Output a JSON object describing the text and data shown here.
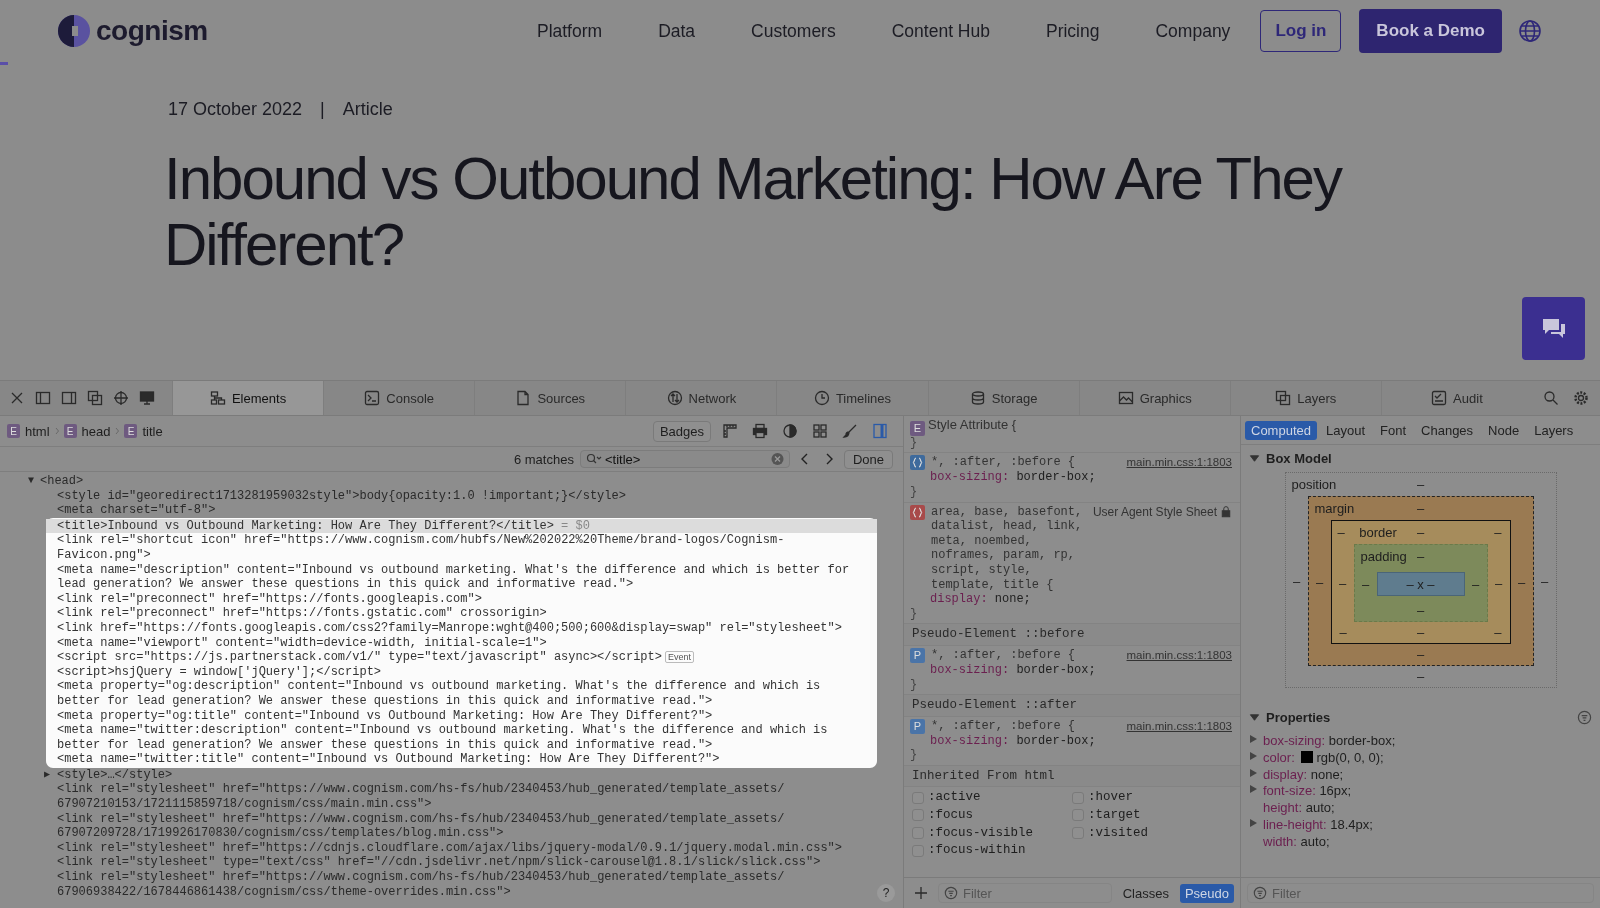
{
  "page": {
    "logo": "cognism",
    "nav": [
      "Platform",
      "Data",
      "Customers",
      "Content Hub",
      "Pricing",
      "Company"
    ],
    "login": "Log in",
    "demo": "Book a Demo",
    "reading_progress": {
      "level": 0.005
    },
    "date": "17 October 2022",
    "separator": "|",
    "category": "Article",
    "headline": "Inbound vs Outbound Marketing: How Are They Different?"
  },
  "devtools": {
    "tabs": [
      {
        "label": "Elements",
        "selected": true
      },
      {
        "label": "Console",
        "selected": false
      },
      {
        "label": "Sources",
        "selected": false
      },
      {
        "label": "Network",
        "selected": false
      },
      {
        "label": "Timelines",
        "selected": false
      },
      {
        "label": "Storage",
        "selected": false
      },
      {
        "label": "Graphics",
        "selected": false
      },
      {
        "label": "Layers",
        "selected": false
      },
      {
        "label": "Audit",
        "selected": false
      }
    ],
    "breadcrumb": [
      {
        "badge": "E",
        "label": "html"
      },
      {
        "badge": "E",
        "label": "head"
      },
      {
        "badge": "E",
        "label": "title"
      }
    ],
    "badges_button": "Badges",
    "search": {
      "matches": "6 matches",
      "value": "<title>",
      "done": "Done"
    },
    "dom": [
      {
        "toggle": "▼",
        "text": "<head>",
        "children": [
          {
            "text": "<style id=\"georedirect1713281959032style\">body{opacity:1.0 !important;}</style>",
            "highlighted": false,
            "selected": false
          },
          {
            "text": "<meta charset=\"utf-8\">",
            "highlighted": false,
            "selected": false
          },
          {
            "text": "<title>Inbound vs Outbound Marketing: How Are They Different?</title>",
            "suffix": "= $0",
            "highlighted": true,
            "selected": true
          },
          {
            "text": "<link rel=\"shortcut icon\" href=\"https://www.cognism.com/hubfs/New%202022%20Theme/brand-logos/Cognism-Favicon.png\">",
            "highlighted": true,
            "selected": false
          },
          {
            "text": "<meta name=\"description\" content=\"Inbound vs outbound marketing. What's the difference and which is better for lead generation? We answer these questions in this quick and informative read.\">",
            "highlighted": true,
            "selected": false
          },
          {
            "text": "<link rel=\"preconnect\" href=\"https://fonts.googleapis.com\">",
            "highlighted": true,
            "selected": false
          },
          {
            "text": "<link rel=\"preconnect\" href=\"https://fonts.gstatic.com\" crossorigin>",
            "highlighted": true,
            "selected": false
          },
          {
            "text": "<link href=\"https://fonts.googleapis.com/css2?family=Manrope:wght@400;500;600&display=swap\" rel=\"stylesheet\">",
            "highlighted": true,
            "selected": false
          },
          {
            "text": "<meta name=\"viewport\" content=\"width=device-width, initial-scale=1\">",
            "highlighted": true,
            "selected": false
          },
          {
            "text": "<script src=\"https://js.partnerstack.com/v1/\" type=\"text/javascript\" async></script>",
            "badge": "Event",
            "highlighted": true,
            "selected": false
          },
          {
            "text": "<script>hsjQuery = window['jQuery'];</script>",
            "highlighted": true,
            "selected": false
          },
          {
            "text": "<meta property=\"og:description\" content=\"Inbound vs outbound marketing. What's the difference and which is better for lead generation? We answer these questions in this quick and informative read.\">",
            "highlighted": true,
            "selected": false
          },
          {
            "text": "<meta property=\"og:title\" content=\"Inbound vs Outbound Marketing: How Are They Different?\">",
            "highlighted": true,
            "selected": false
          },
          {
            "text": "<meta name=\"twitter:description\" content=\"Inbound vs outbound marketing. What's the difference and which is better for lead generation? We answer these questions in this quick and informative read.\">",
            "highlighted": true,
            "selected": false
          },
          {
            "text": "<meta name=\"twitter:title\" content=\"Inbound vs Outbound Marketing: How Are They Different?\">",
            "highlighted": true,
            "selected": false
          },
          {
            "toggle": "▶",
            "text": "<style>…</style>",
            "highlighted": false,
            "selected": false
          },
          {
            "text": "<link rel=\"stylesheet\" href=\"https://www.cognism.com/hs-fs/hub/2340453/hub_generated/template_assets/67907210153/1721115859718/cognism/css/main.min.css\">",
            "highlighted": false,
            "selected": false
          },
          {
            "text": "<link rel=\"stylesheet\" href=\"https://www.cognism.com/hs-fs/hub/2340453/hub_generated/template_assets/67907209728/1719926170830/cognism/css/templates/blog.min.css\">",
            "highlighted": false,
            "selected": false
          },
          {
            "text": "<link rel=\"stylesheet\" href=\"https://cdnjs.cloudflare.com/ajax/libs/jquery-modal/0.9.1/jquery.modal.min.css\">",
            "highlighted": false,
            "selected": false
          },
          {
            "text": "<link rel=\"stylesheet\" type=\"text/css\" href=\"//cdn.jsdelivr.net/npm/slick-carousel@1.8.1/slick/slick.css\">",
            "highlighted": false,
            "selected": false
          },
          {
            "text": "<link rel=\"stylesheet\" href=\"https://www.cognism.com/hs-fs/hub/2340453/hub_generated/template_assets/67906938422/1678446861438/cognism/css/theme-overrides.min.css\">",
            "highlighted": false,
            "selected": false
          }
        ]
      }
    ],
    "help": "?",
    "styles": {
      "sections": [
        {
          "rules": [
            {
              "kind": "attribute",
              "badge": "E",
              "selector": "Style Attribute {",
              "closing": "}"
            },
            {
              "kind": "author",
              "selector": "*, :after, :before {",
              "source": "main.min.css:1:1803",
              "declarations": [
                {
                  "property": "box-sizing:",
                  "value": "border-box;"
                }
              ],
              "closing": "}"
            },
            {
              "kind": "user-agent",
              "selector": "area, base, basefont, datalist, head, link, meta, noembed, noframes, param, rp, script, style, template, title {",
              "source": "User Agent Style Sheet",
              "declarations": [
                {
                  "property": "display:",
                  "value": "none;"
                }
              ],
              "closing": "}"
            }
          ]
        },
        {
          "title": "Pseudo-Element ::before",
          "rules": [
            {
              "kind": "pseudo",
              "badge": "P",
              "selector": "*, :after, :before {",
              "source": "main.min.css:1:1803",
              "declarations": [
                {
                  "property": "box-sizing:",
                  "value": "border-box;"
                }
              ],
              "closing": "}"
            }
          ]
        },
        {
          "title": "Pseudo-Element ::after",
          "rules": [
            {
              "kind": "pseudo",
              "badge": "P",
              "selector": "*, :after, :before {",
              "source": "main.min.css:1:1803",
              "declarations": [
                {
                  "property": "box-sizing:",
                  "value": "border-box;"
                }
              ],
              "closing": "}"
            }
          ]
        },
        {
          "title": "Inherited From html"
        }
      ],
      "pseudo_classes": [
        {
          "label": ":active",
          "checked": false
        },
        {
          "label": ":hover",
          "checked": false
        },
        {
          "label": ":focus",
          "checked": false
        },
        {
          "label": ":target",
          "checked": false
        },
        {
          "label": ":focus-visible",
          "checked": false
        },
        {
          "label": ":visited",
          "checked": false
        },
        {
          "label": ":focus-within",
          "checked": false
        }
      ],
      "filter_placeholder": "Filter",
      "classes": {
        "label": "Classes",
        "selected": false
      },
      "pseudo": {
        "label": "Pseudo",
        "selected": true
      }
    },
    "sidebar": {
      "tabs": [
        {
          "label": "Computed",
          "selected": true
        },
        {
          "label": "Layout",
          "selected": false
        },
        {
          "label": "Font",
          "selected": false
        },
        {
          "label": "Changes",
          "selected": false
        },
        {
          "label": "Node",
          "selected": false
        },
        {
          "label": "Layers",
          "selected": false
        }
      ],
      "box_model": {
        "title": "Box Model",
        "box": {
          "kind": "position",
          "label": "position",
          "top": "–",
          "left": "–",
          "inner": {
            "kind": "margin",
            "label": "margin",
            "top": "–",
            "left": "–",
            "inner": {
              "kind": "border",
              "corner_top_left": "–",
              "label": "border",
              "top": "–",
              "corner_top_right": "–",
              "left": "–",
              "inner": {
                "kind": "padding",
                "label": "padding",
                "top": "–",
                "left": "–",
                "content": "– x –",
                "right": "–",
                "bottom": "–"
              },
              "right": "–",
              "corner_bottom_left": "–",
              "bottom": "–",
              "corner_bottom_right": "–"
            },
            "right": "–",
            "bottom": "–"
          },
          "right": "–",
          "bottom": "–"
        }
      },
      "properties": {
        "title": "Properties",
        "items": [
          {
            "property": "box-sizing:",
            "value": "border-box;",
            "expandable": true
          },
          {
            "property": "color:",
            "color": "#000000",
            "value": "rgb(0, 0, 0);",
            "expandable": true
          },
          {
            "property": "display:",
            "value": "none;",
            "expandable": true
          },
          {
            "property": "font-size:",
            "value": "16px;",
            "expandable": true
          },
          {
            "property": "height:",
            "value": "auto;",
            "expandable": false
          },
          {
            "property": "line-height:",
            "value": "18.4px;",
            "expandable": true
          },
          {
            "property": "width:",
            "value": "auto;",
            "expandable": false
          }
        ]
      },
      "filter_placeholder": "Filter"
    }
  }
}
